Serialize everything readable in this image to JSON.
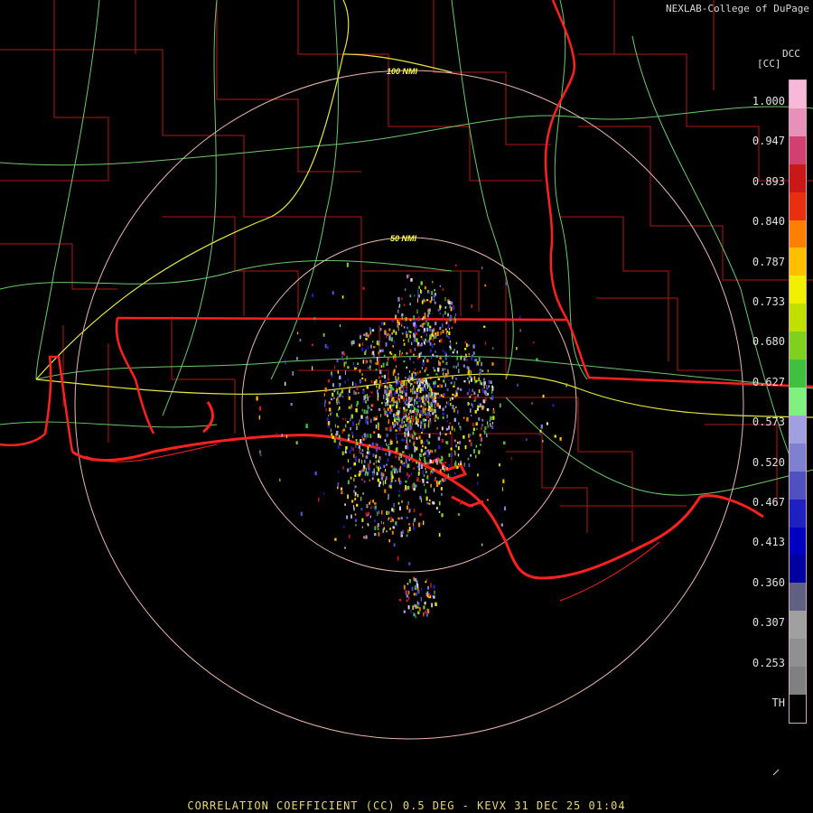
{
  "credit": "NEXLAB-College of DuPage",
  "product_code": "DCC",
  "unit_label": "[CC]",
  "ring_labels": [
    "100 NMI",
    "50 NMI"
  ],
  "legend_ticks": [
    "1.000",
    "0.947",
    "0.893",
    "0.840",
    "0.787",
    "0.733",
    "0.680",
    "0.627",
    "0.573",
    "0.520",
    "0.467",
    "0.413",
    "0.360",
    "0.307",
    "0.253",
    "TH"
  ],
  "legend_colors": [
    "#f8b8d8",
    "#e890b8",
    "#d04070",
    "#c81818",
    "#e83010",
    "#ff8000",
    "#ffc000",
    "#f0f000",
    "#c0e000",
    "#80d020",
    "#40c040",
    "#80f080",
    "#a0a0e0",
    "#8080d0",
    "#5050c0",
    "#2020c0",
    "#0000c0",
    "#0000a0",
    "#606080",
    "#a0a0a0",
    "#909090",
    "#808080",
    "#000000"
  ],
  "footer": "CORRELATION COEFFICIENT (CC) 0.5 DEG - KEVX 31 DEC 25 01:04",
  "colors": {
    "state_border": "#ff2020",
    "county": "#c01818",
    "highway": "#70d070",
    "interstate": "#e8e840",
    "range_ring": "#e8b8a8"
  }
}
